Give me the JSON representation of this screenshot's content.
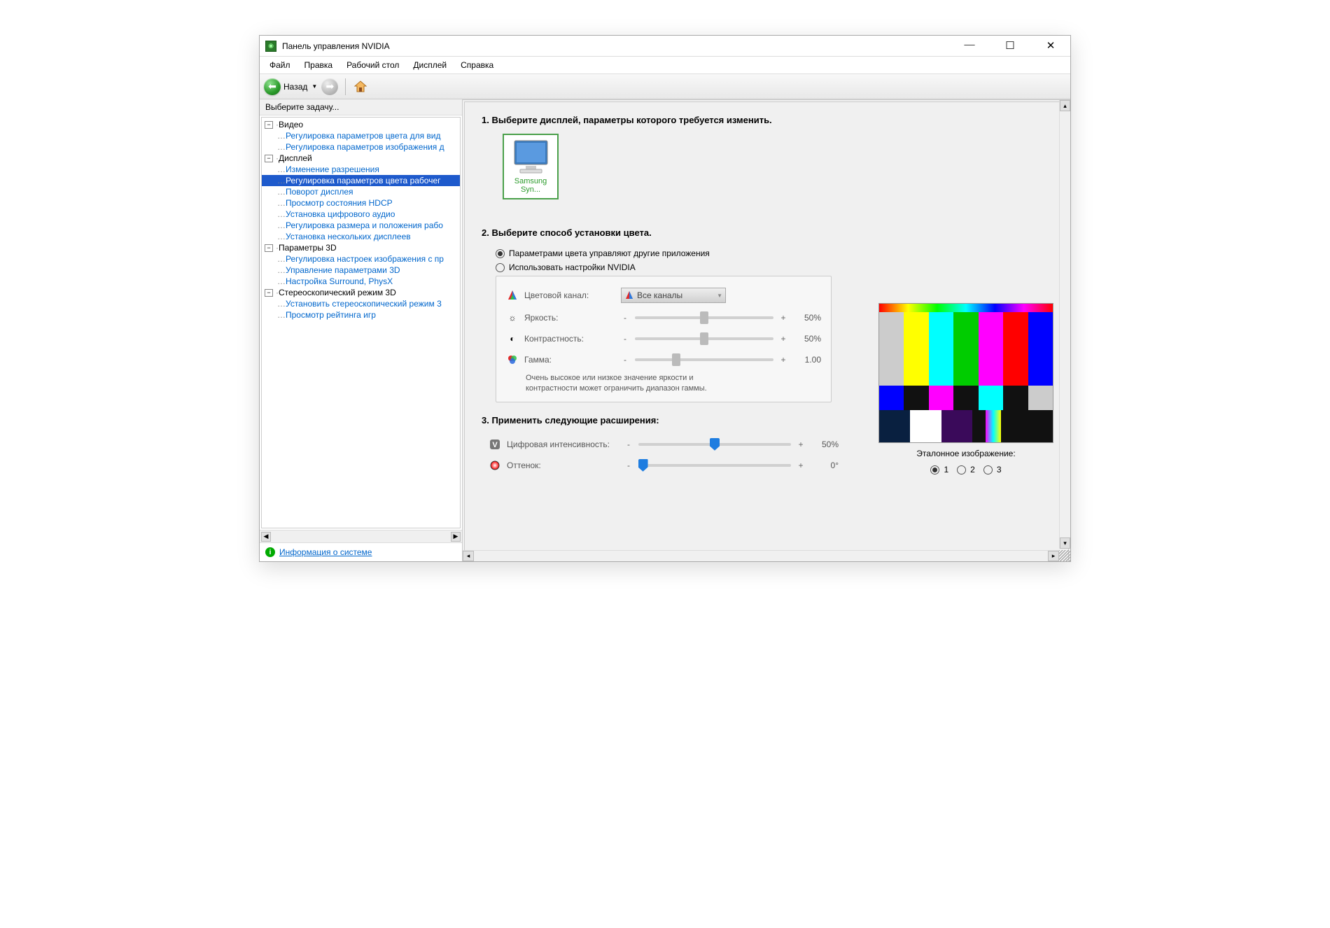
{
  "title": "Панель управления NVIDIA",
  "menu": {
    "file": "Файл",
    "edit": "Правка",
    "desktop": "Рабочий стол",
    "display": "Дисплей",
    "help": "Справка"
  },
  "toolbar": {
    "back": "Назад"
  },
  "sidebar": {
    "header": "Выберите задачу...",
    "groups": [
      {
        "label": "Видео",
        "items": [
          "Регулировка параметров цвета для вид",
          "Регулировка параметров изображения д"
        ]
      },
      {
        "label": "Дисплей",
        "items": [
          "Изменение разрешения",
          "Регулировка параметров цвета рабочег",
          "Поворот дисплея",
          "Просмотр состояния HDCP",
          "Установка цифрового аудио",
          "Регулировка размера и положения рабо",
          "Установка нескольких дисплеев"
        ],
        "selected": 1
      },
      {
        "label": "Параметры 3D",
        "items": [
          "Регулировка настроек изображения с пр",
          "Управление параметрами 3D",
          "Настройка Surround, PhysX"
        ]
      },
      {
        "label": "Стереоскопический режим 3D",
        "items": [
          "Установить стереоскопический режим 3",
          "Просмотр рейтинга игр"
        ]
      }
    ],
    "info_link": "Информация о системе"
  },
  "main": {
    "s1_title": "1. Выберите дисплей, параметры которого требуется изменить.",
    "display_name": "Samsung Syn...",
    "s2_title": "2. Выберите способ установки цвета.",
    "radio1": "Параметрами цвета управляют другие приложения",
    "radio2": "Использовать настройки NVIDIA",
    "channel_label": "Цветовой канал:",
    "channel_value": "Все каналы",
    "sliders": {
      "brightness": {
        "label": "Яркость:",
        "value": "50%",
        "pos": 50
      },
      "contrast": {
        "label": "Контрастность:",
        "value": "50%",
        "pos": 50
      },
      "gamma": {
        "label": "Гамма:",
        "value": "1.00",
        "pos": 30
      }
    },
    "hint1": "Очень высокое или низкое значение яркости и",
    "hint2": "контрастности может ограничить диапазон гаммы.",
    "s3_title": "3. Применить следующие расширения:",
    "intensity": {
      "label": "Цифровая интенсивность:",
      "value": "50%",
      "pos": 50
    },
    "hue": {
      "label": "Оттенок:",
      "value": "0°",
      "pos": 2
    },
    "ref_label": "Эталонное изображение:",
    "ref_options": {
      "r1": "1",
      "r2": "2",
      "r3": "3"
    }
  }
}
